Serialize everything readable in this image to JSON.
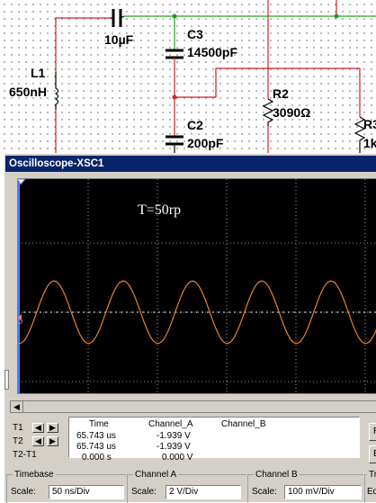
{
  "schematic": {
    "c1": {
      "value": "10µF"
    },
    "c3": {
      "name": "C3",
      "value": "14500pF"
    },
    "l1": {
      "name": "L1",
      "value": "650nH"
    },
    "r2": {
      "name": "R2",
      "value": "3090Ω"
    },
    "c2": {
      "name": "C2",
      "value": "200pF"
    },
    "r3": {
      "name": "R3",
      "value": "1k"
    }
  },
  "oscilloscope": {
    "title": "Oscilloscope-XSC1",
    "annotation": "T=50rp",
    "colors": {
      "screen": "#000000",
      "grid": "#c8c8c8",
      "trace": "#ff8c28",
      "titlebar": "#0a246a"
    },
    "waveform": {
      "cycles_visible": 5.2,
      "period_grid_divisions": 1.0,
      "amplitude_divisions": 0.45
    },
    "readout": {
      "row_labels": [
        "T1",
        "T2",
        "T2-T1"
      ],
      "headers": {
        "time": "Time",
        "channel_a": "Channel_A",
        "channel_b": "Channel_B"
      },
      "t1": {
        "time": "65.743 us",
        "channel_a": "-1.939 V"
      },
      "t2": {
        "time": "65.743 us",
        "channel_a": "-1.939 V"
      },
      "t2_t1": {
        "time": "0.000 s",
        "channel_a": "0.000 V"
      },
      "reverse_label": "R",
      "side_label": "Ed"
    },
    "timebase": {
      "title": "Timebase",
      "scale_label": "Scale:",
      "scale": "50 ns/Div"
    },
    "channel_a": {
      "title": "Channel A",
      "scale_label": "Scale:",
      "scale": "2  V/Div"
    },
    "channel_b": {
      "title": "Channel B",
      "scale_label": "Scale:",
      "scale": "100 mV/Div"
    },
    "trigger": {
      "title": "Tr",
      "edge_label": "Ed"
    }
  }
}
